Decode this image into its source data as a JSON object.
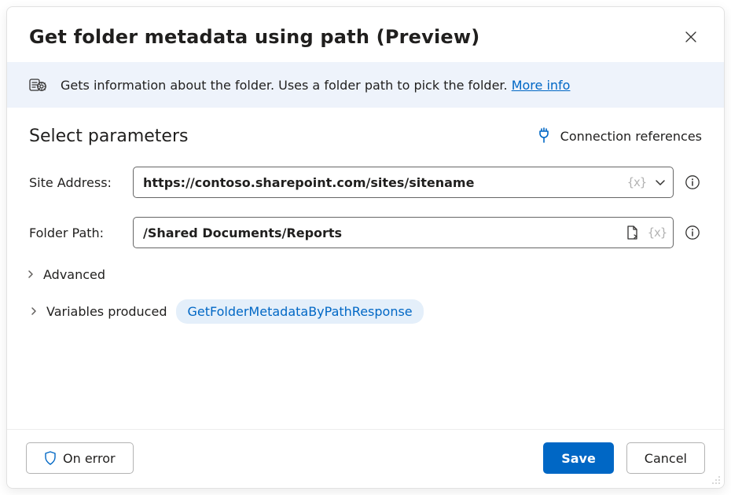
{
  "header": {
    "title": "Get folder metadata using path (Preview)"
  },
  "banner": {
    "text": "Gets information about the folder. Uses a folder path to pick the folder. ",
    "link_label": "More info"
  },
  "section": {
    "title": "Select parameters",
    "connection_references": "Connection references"
  },
  "params": {
    "site_address": {
      "label": "Site Address:",
      "value": "https://contoso.sharepoint.com/sites/sitename"
    },
    "folder_path": {
      "label": "Folder Path:",
      "value": "/Shared Documents/Reports"
    }
  },
  "advanced_label": "Advanced",
  "variables": {
    "label": "Variables produced",
    "chip": "GetFolderMetadataByPathResponse"
  },
  "footer": {
    "on_error": "On error",
    "save": "Save",
    "cancel": "Cancel"
  },
  "tokens": {
    "fx": "{x}"
  }
}
